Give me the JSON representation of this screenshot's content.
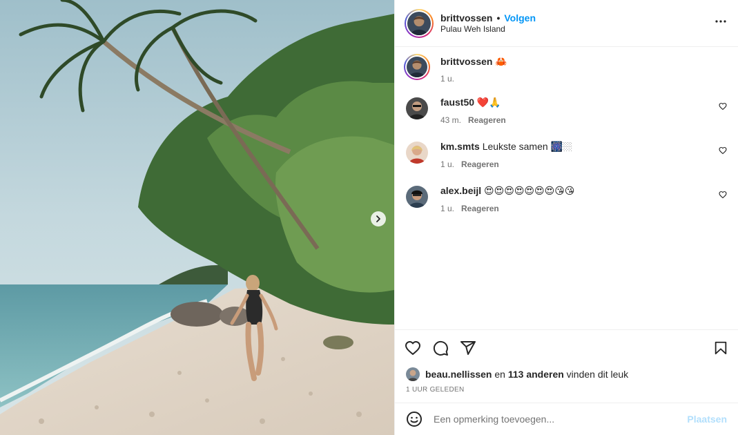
{
  "post": {
    "photo_description_icon": "beach-photo",
    "carousel_next_icon": "chevron-right-icon"
  },
  "header": {
    "username": "brittvossen",
    "separator": "•",
    "follow_label": "Volgen",
    "location": "Pulau Weh Island",
    "more_icon": "more-horizontal-icon"
  },
  "caption": {
    "username": "brittvossen",
    "text": "🦀",
    "time": "1 u."
  },
  "comments": [
    {
      "username": "faust50",
      "text": "❤️🙏",
      "time": "43 m.",
      "reply_label": "Reageren"
    },
    {
      "username": "km.smts",
      "text": "Leukste samen 🎆🏼",
      "time": "1 u.",
      "reply_label": "Reageren"
    },
    {
      "username": "alex.beijl",
      "text": "😍😍😍😍😍😍😍😘😘",
      "time": "1 u.",
      "reply_label": "Reageren"
    }
  ],
  "actions": {
    "like_icon": "heart-icon",
    "comment_icon": "comment-icon",
    "share_icon": "share-icon",
    "save_icon": "bookmark-icon"
  },
  "likes": {
    "liker": "beau.nellissen",
    "conj": " en ",
    "count_text": "113 anderen",
    "suffix": " vinden dit leuk"
  },
  "timestamp": "1 uur geleden",
  "add_comment": {
    "emoji_icon": "smiley-icon",
    "placeholder": "Een opmerking toevoegen...",
    "post_label": "Plaatsen"
  },
  "colors": {
    "accent": "#0095f6",
    "post_disabled": "#b2dffc",
    "secondary_text": "#737373",
    "border": "#efefef"
  }
}
